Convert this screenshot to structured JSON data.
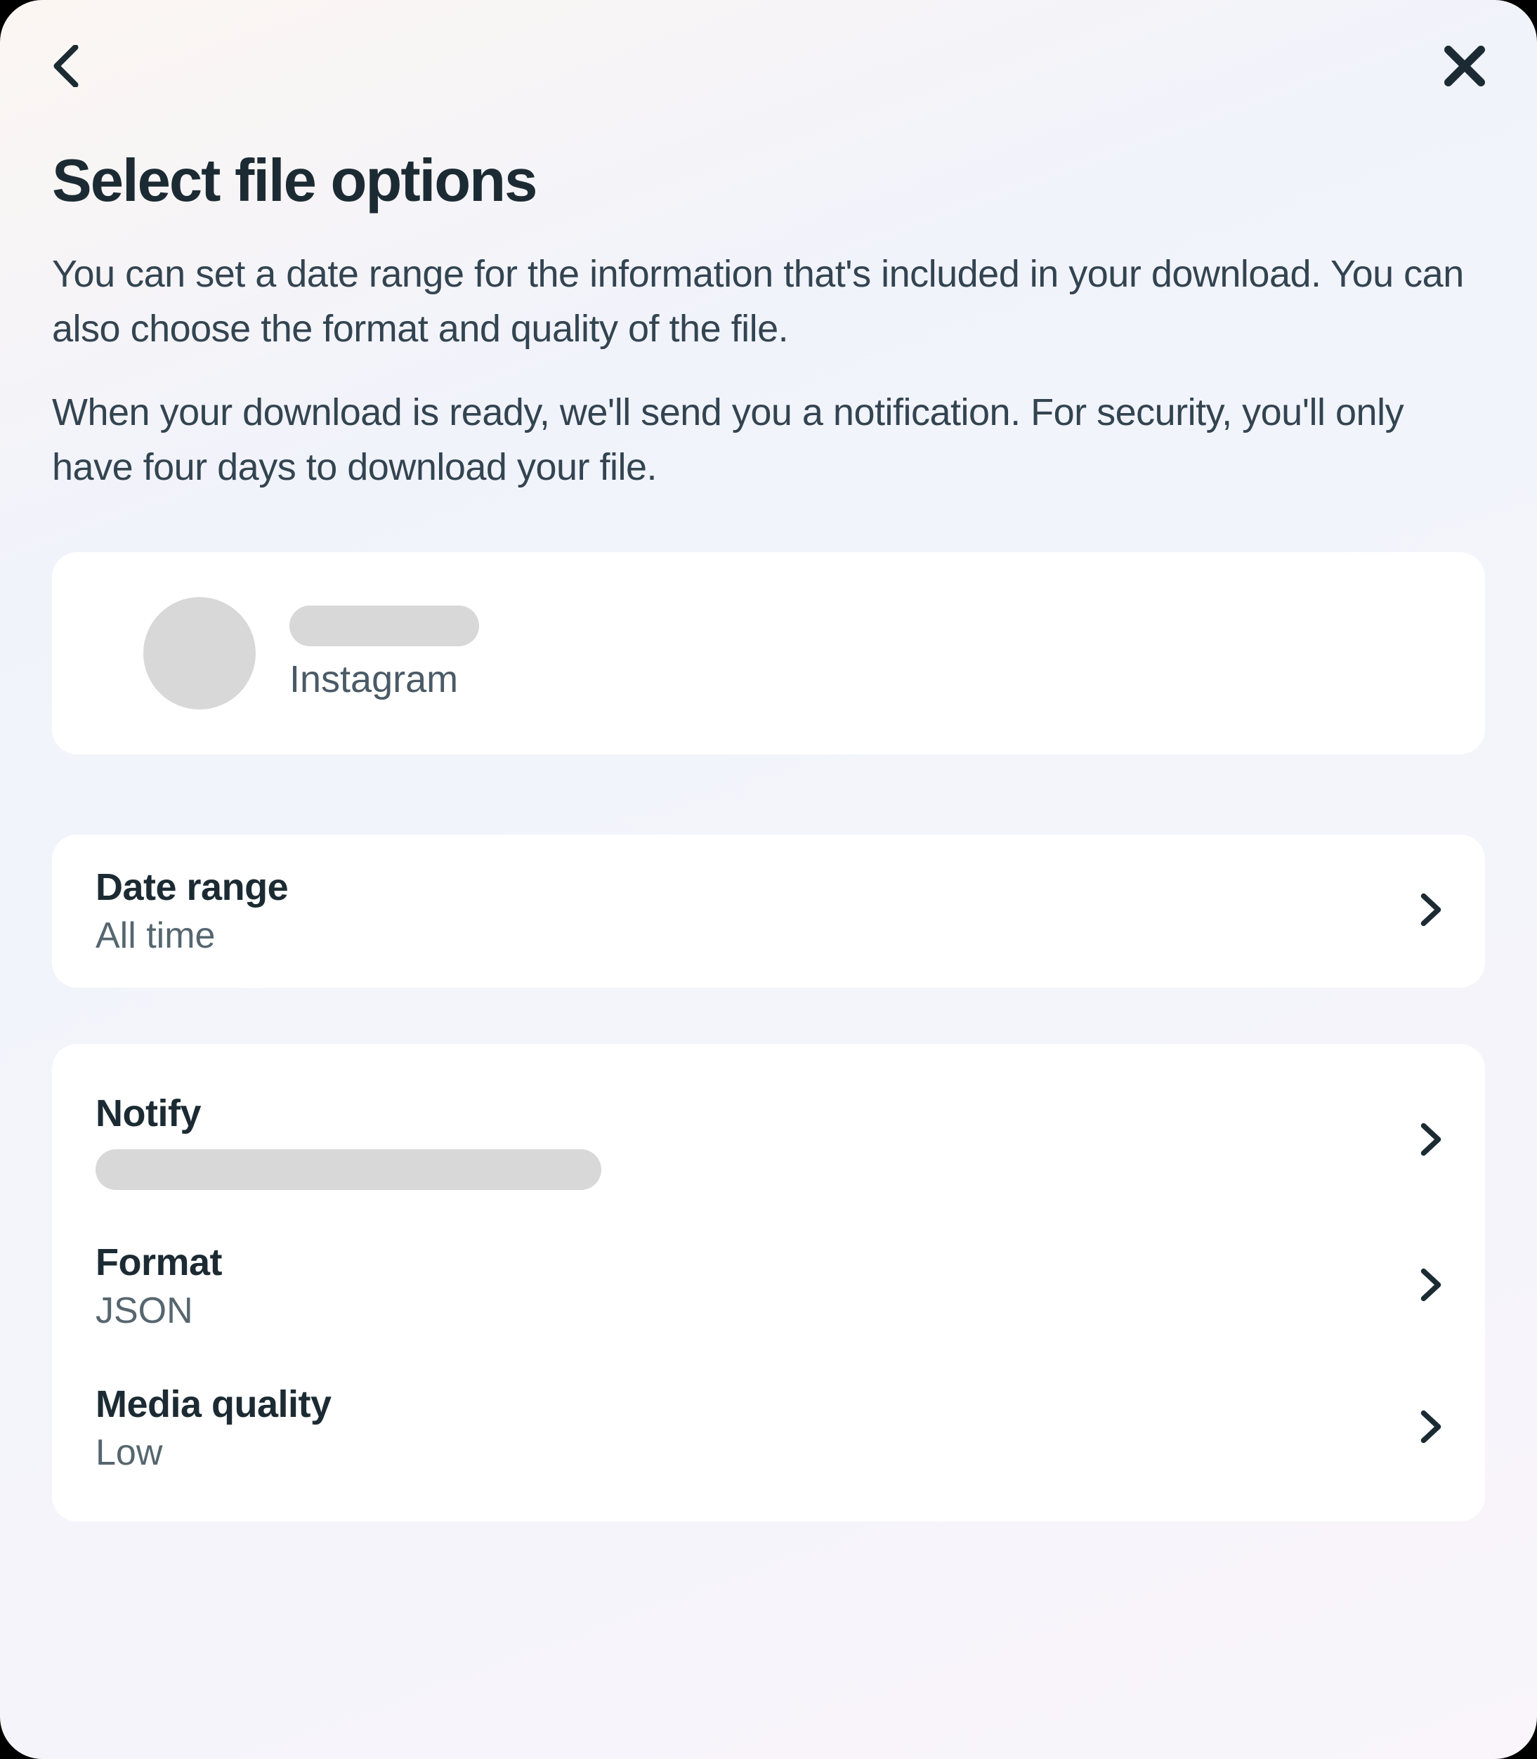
{
  "header": {
    "title": "Select file options",
    "description1": "You can set a date range for the information that's included in your download. You can also choose the format and quality of the file.",
    "description2": "When your download is ready, we'll send you a notification. For security, you'll only have four days to download your file."
  },
  "account": {
    "platform": "Instagram"
  },
  "options": {
    "dateRange": {
      "label": "Date range",
      "value": "All time"
    },
    "notify": {
      "label": "Notify"
    },
    "format": {
      "label": "Format",
      "value": "JSON"
    },
    "mediaQuality": {
      "label": "Media quality",
      "value": "Low"
    }
  }
}
